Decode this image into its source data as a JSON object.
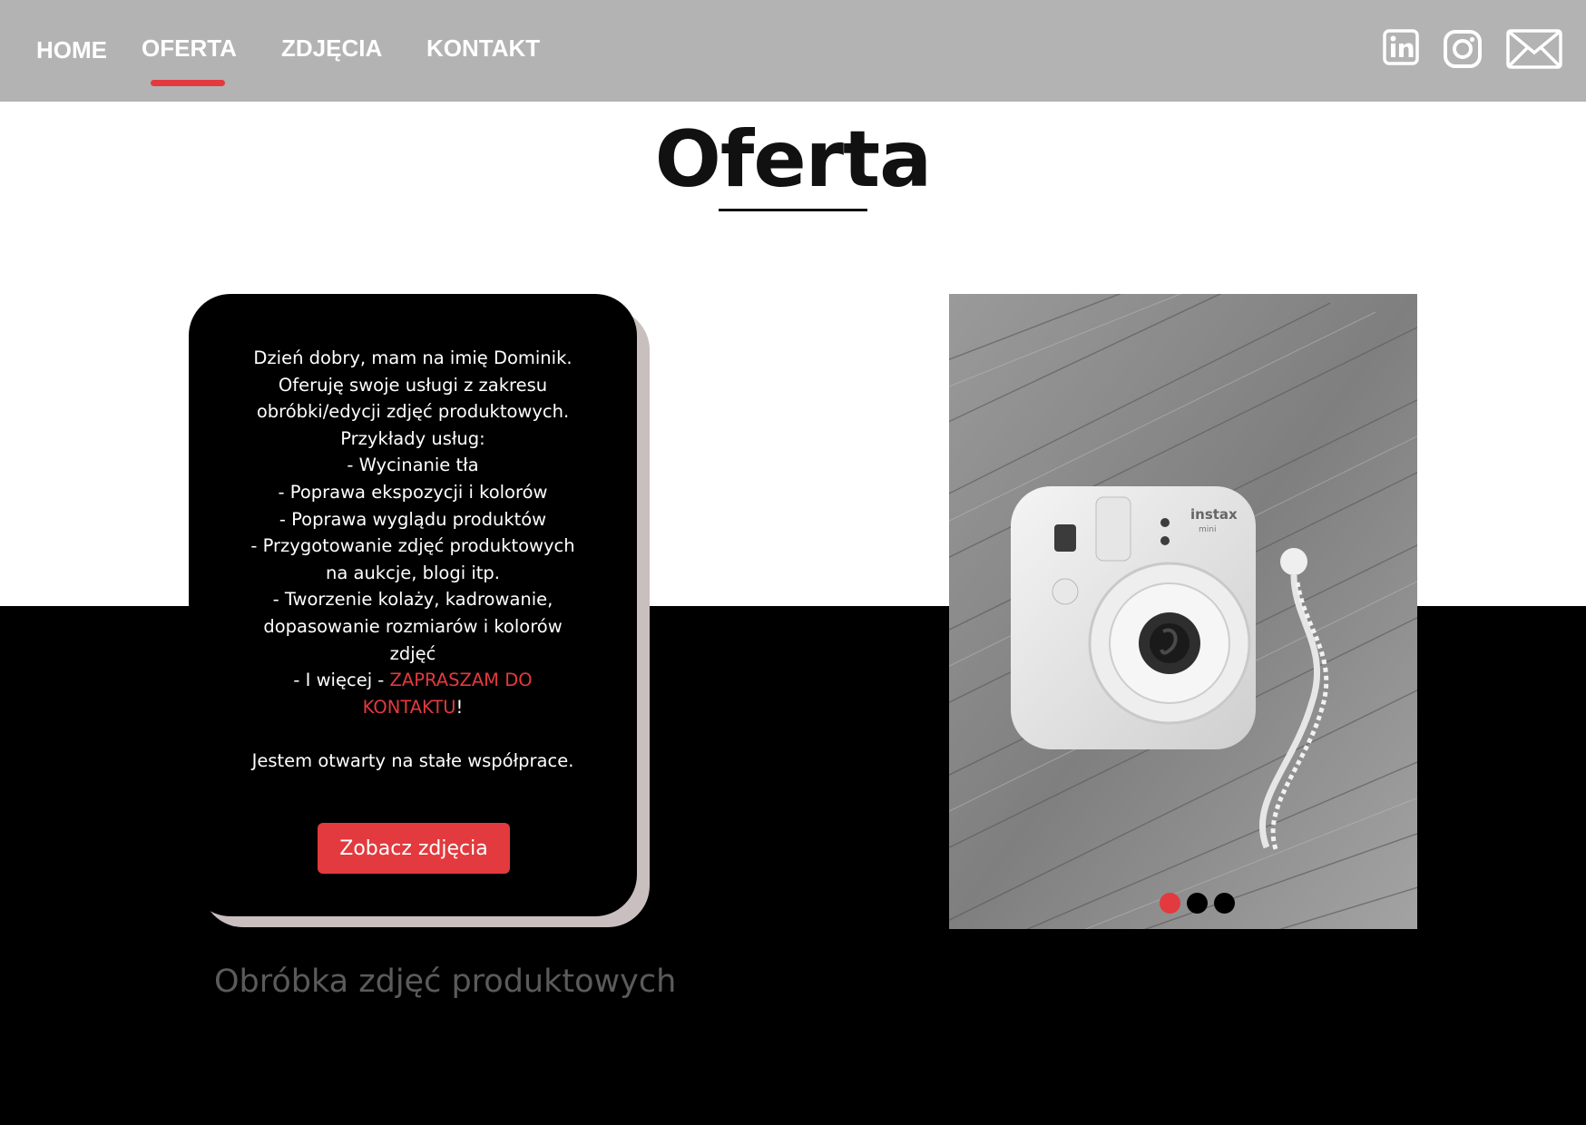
{
  "nav": {
    "items": [
      {
        "label": "HOME"
      },
      {
        "label": "OFERTA"
      },
      {
        "label": "ZDJĘCIA"
      },
      {
        "label": "KONTAKT"
      }
    ],
    "active": "OFERTA"
  },
  "social": [
    "linkedin-icon",
    "instagram-icon",
    "mail-icon"
  ],
  "page": {
    "title": "Oferta"
  },
  "card": {
    "lines": [
      "Dzień dobry, mam na imię Dominik.",
      "Oferuję swoje usługi z zakresu",
      "obróbki/edycji zdjęć produktowych.",
      "Przykłady usług:",
      "- Wycinanie tła",
      "- Poprawa ekspozycji i kolorów",
      "- Poprawa wyglądu produktów",
      "- Przygotowanie zdjęć produktowych",
      "na aukcje, blogi itp.",
      "- Tworzenie kolaży, kadrowanie,",
      "dopasowanie rozmiarów i kolorów",
      "zdjęć"
    ],
    "more_prefix": "- I więcej - ",
    "more_link_1": "ZAPRASZAM DO",
    "more_link_2": "KONTAKTU",
    "more_suffix": "!",
    "closing": "Jestem otwarty na stałe współprace.",
    "button_label": "Zobacz zdjęcia"
  },
  "subtitle": "Obróbka zdjęć produktowych",
  "carousel": {
    "count": 3,
    "active_index": 0
  },
  "colors": {
    "accent": "#e23a3e",
    "nav_bg": "#b3b3b3",
    "band": "#000000",
    "card_shadow": "#c9bfbf",
    "subtitle": "#5b5b5b"
  }
}
